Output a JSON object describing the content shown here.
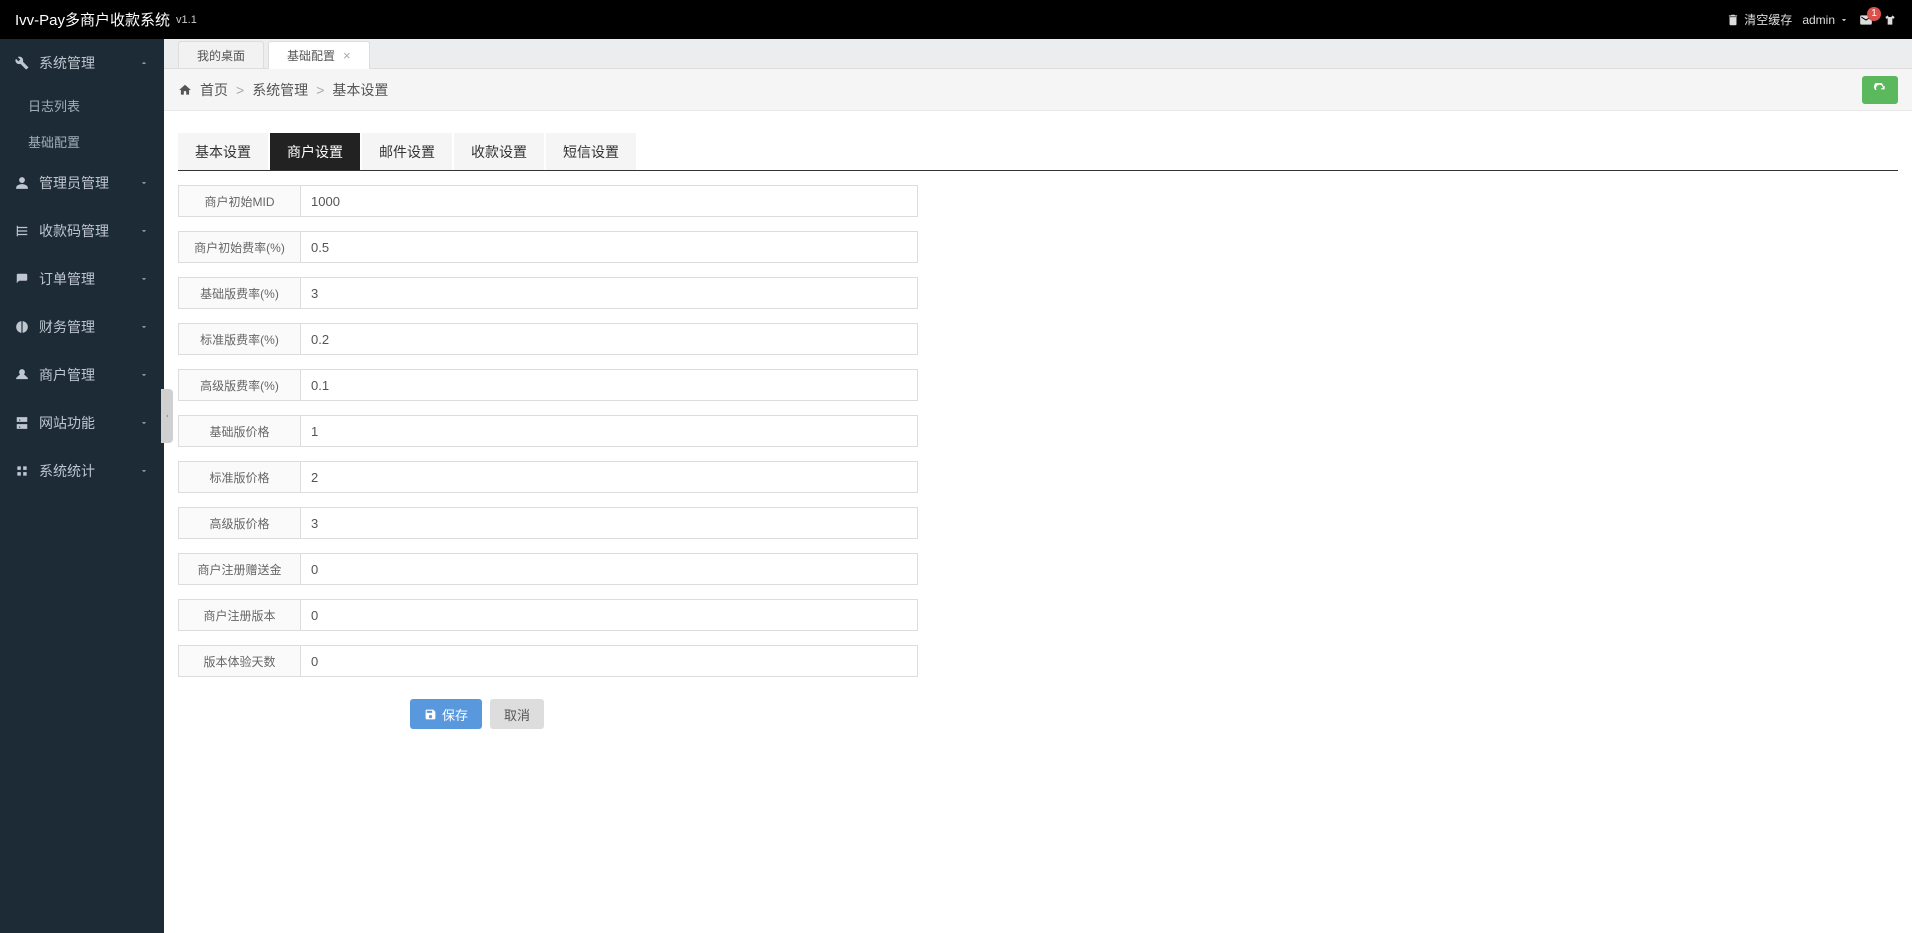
{
  "header": {
    "title": "Ivv-Pay多商户收款系统",
    "version": "v1.1",
    "clear_cache": "清空缓存",
    "admin": "admin",
    "msg_count": "1"
  },
  "sidebar": {
    "items": [
      {
        "label": "系统管理",
        "expanded": true
      },
      {
        "label": "管理员管理"
      },
      {
        "label": "收款码管理"
      },
      {
        "label": "订单管理"
      },
      {
        "label": "财务管理"
      },
      {
        "label": "商户管理"
      },
      {
        "label": "网站功能"
      },
      {
        "label": "系统统计"
      }
    ],
    "sub": [
      {
        "label": "日志列表"
      },
      {
        "label": "基础配置"
      }
    ]
  },
  "tabs": [
    {
      "label": "我的桌面",
      "closable": false
    },
    {
      "label": "基础配置",
      "closable": true,
      "active": true
    }
  ],
  "breadcrumb": {
    "home": "首页",
    "p1": "系统管理",
    "p2": "基本设置"
  },
  "inner_tabs": [
    {
      "label": "基本设置"
    },
    {
      "label": "商户设置",
      "active": true
    },
    {
      "label": "邮件设置"
    },
    {
      "label": "收款设置"
    },
    {
      "label": "短信设置"
    }
  ],
  "form": [
    {
      "label": "商户初始MID",
      "value": "1000"
    },
    {
      "label": "商户初始费率(%)",
      "value": "0.5"
    },
    {
      "label": "基础版费率(%)",
      "value": "3"
    },
    {
      "label": "标准版费率(%)",
      "value": "0.2"
    },
    {
      "label": "高级版费率(%)",
      "value": "0.1"
    },
    {
      "label": "基础版价格",
      "value": "1"
    },
    {
      "label": "标准版价格",
      "value": "2"
    },
    {
      "label": "高级版价格",
      "value": "3"
    },
    {
      "label": "商户注册赠送金",
      "value": "0"
    },
    {
      "label": "商户注册版本",
      "value": "0"
    },
    {
      "label": "版本体验天数",
      "value": "0"
    }
  ],
  "buttons": {
    "save": "保存",
    "cancel": "取消"
  }
}
